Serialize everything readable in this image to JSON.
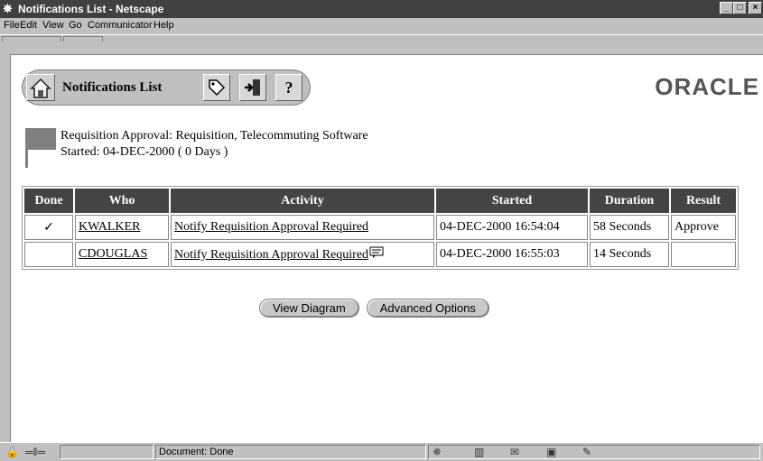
{
  "window": {
    "title": "Notifications List - Netscape"
  },
  "menu": [
    "File",
    "Edit",
    "View",
    "Go",
    "Communicator",
    "Help"
  ],
  "toolbar": {
    "title": "Notifications List",
    "help_glyph": "?"
  },
  "brand": {
    "logo_text": "ORACLE"
  },
  "process": {
    "line1": "Requisition Approval: Requisition, Telecommuting Software",
    "line2": "Started: 04-DEC-2000 ( 0 Days )"
  },
  "table": {
    "headers": [
      "Done",
      "Who",
      "Activity",
      "Started",
      "Duration",
      "Result"
    ],
    "rows": [
      {
        "done": "✓",
        "who": "KWALKER",
        "activity": "Notify Requisition Approval Required",
        "started": "04-DEC-2000 16:54:04",
        "duration": "58 Seconds",
        "result": "Approve"
      },
      {
        "done": "",
        "who": "CDOUGLAS",
        "activity": "Notify Requisition Approval Required",
        "started": "04-DEC-2000 16:55:03",
        "duration": "14 Seconds",
        "result": ""
      }
    ]
  },
  "buttons": {
    "view_diagram": "View Diagram",
    "advanced_options": "Advanced Options"
  },
  "status": {
    "text": "Document: Done"
  },
  "colors": {
    "title_bar": "#404040",
    "header_bg": "#444444",
    "chrome": "#c0c0c0",
    "flag": "#808080"
  }
}
